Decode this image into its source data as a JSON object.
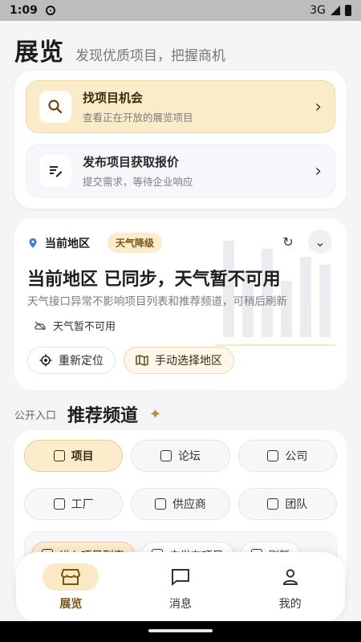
{
  "status_bar": {
    "time": "1:09",
    "network": "3G"
  },
  "header": {
    "title": "展览",
    "subtitle": "发现优质项目，把握商机"
  },
  "actions": [
    {
      "title": "找项目机会",
      "subtitle": "查看正在开放的展览项目",
      "icon": "search-icon"
    },
    {
      "title": "发布项目获取报价",
      "subtitle": "提交需求，等待企业响应",
      "icon": "edit-list-icon"
    }
  ],
  "region": {
    "label": "当前地区",
    "badge": "天气降级",
    "title": "当前地区 已同步，天气暂不可用",
    "description": "天气接口异常不影响项目列表和推荐频道，可稍后刷新",
    "weather_text": "天气暂不可用",
    "relocate_label": "重新定位",
    "choose_label": "手动选择地区"
  },
  "channels_section": {
    "small_label": "公开入口",
    "title": "推荐频道",
    "chips": [
      {
        "label": "项目",
        "active": true
      },
      {
        "label": "论坛",
        "active": false
      },
      {
        "label": "公司",
        "active": false
      },
      {
        "label": "工厂",
        "active": false
      },
      {
        "label": "供应商",
        "active": false
      },
      {
        "label": "团队",
        "active": false
      }
    ],
    "strip": [
      "进入项目列表",
      "去发布项目",
      "刷新"
    ]
  },
  "nav": [
    {
      "label": "展览",
      "icon": "store-icon",
      "active": true
    },
    {
      "label": "消息",
      "icon": "message-icon",
      "active": false
    },
    {
      "label": "我的",
      "icon": "person-icon",
      "active": false
    }
  ],
  "colors": {
    "accent": "#fbecc9",
    "accent_text": "#7a5512"
  }
}
